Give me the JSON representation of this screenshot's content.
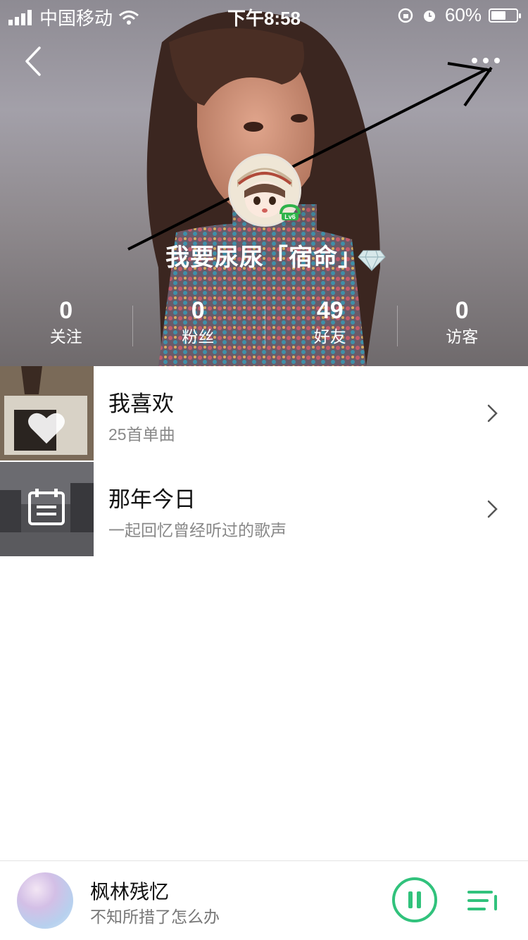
{
  "status_bar": {
    "carrier": "中国移动",
    "time": "下午8:58",
    "battery": "60%",
    "battery_level": 0.6,
    "icons": [
      "signal-icon",
      "wifi-icon",
      "orientation-lock-icon",
      "alarm-icon",
      "battery-icon"
    ]
  },
  "header": {
    "back_icon": "chevron-left-icon",
    "more_icon": "more-dots-icon"
  },
  "profile": {
    "username": "我要尿尿「宿命」",
    "level_badge": "Lv6",
    "vip_icon": "diamond-icon"
  },
  "stats": [
    {
      "value": "0",
      "label": "关注"
    },
    {
      "value": "0",
      "label": "粉丝"
    },
    {
      "value": "49",
      "label": "好友"
    },
    {
      "value": "0",
      "label": "访客"
    }
  ],
  "lists": [
    {
      "title": "我喜欢",
      "subtitle": "25首单曲",
      "icon": "heart-icon"
    },
    {
      "title": "那年今日",
      "subtitle": "一起回忆曾经听过的歌声",
      "icon": "calendar-icon"
    }
  ],
  "player": {
    "song": "枫林残忆",
    "subtitle": "不知所措了怎么办",
    "play_icon": "pause-icon",
    "list_icon": "playlist-icon",
    "accent": "#31c27c"
  }
}
